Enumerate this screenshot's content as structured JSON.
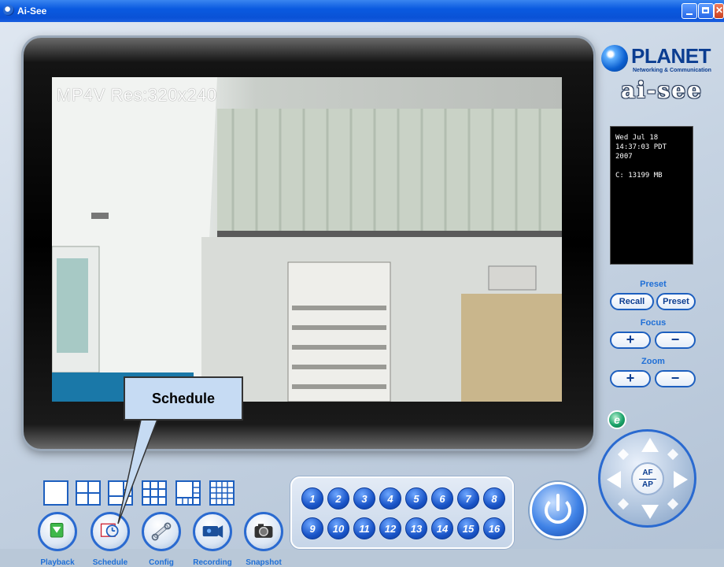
{
  "window": {
    "title": "Ai-See"
  },
  "video": {
    "overlay": "MP4V Res:320x240"
  },
  "branding": {
    "planet": "PLANET",
    "planet_tagline": "Networking & Communication",
    "aisee": "ai-see"
  },
  "info": {
    "date_line1": "Wed Jul 18",
    "date_line2": "14:37:03 PDT",
    "date_line3": "2007",
    "disk": "C: 13199 MB"
  },
  "preset": {
    "label": "Preset",
    "recall": "Recall",
    "preset": "Preset"
  },
  "focus": {
    "label": "Focus",
    "plus": "+",
    "minus": "−"
  },
  "zoom": {
    "label": "Zoom",
    "plus": "+",
    "minus": "−"
  },
  "joystick": {
    "af": "AF",
    "ap": "AP"
  },
  "channels": [
    "1",
    "2",
    "3",
    "4",
    "5",
    "6",
    "7",
    "8",
    "9",
    "10",
    "11",
    "12",
    "13",
    "14",
    "15",
    "16"
  ],
  "tools": {
    "playback": "Playback",
    "schedule": "Schedule",
    "config": "Config",
    "recording": "Recording",
    "snapshot": "Snapshot"
  },
  "callout": {
    "text": "Schedule"
  },
  "icons": [
    "app-icon",
    "minimize-icon",
    "maximize-icon",
    "close-icon",
    "ie-icon",
    "power-icon",
    "playback-icon",
    "schedule-icon",
    "config-icon",
    "recording-icon",
    "snapshot-icon"
  ],
  "colors": {
    "accent": "#1f6fd6",
    "titlebar": "#0a5ae0",
    "callout_bg": "#c6dbf3"
  }
}
